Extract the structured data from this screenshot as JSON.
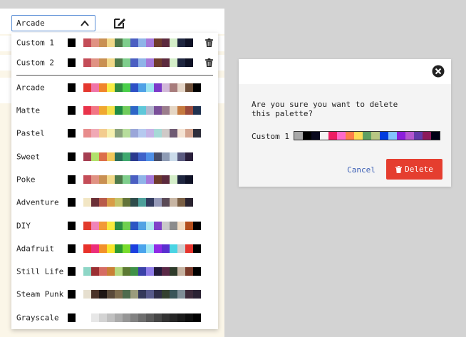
{
  "selector": {
    "selected": "Arcade"
  },
  "palettes": [
    {
      "name": "Custom 1",
      "deletable": true,
      "colors": [
        "#000000",
        "#c44d58",
        "#e09283",
        "#c99052",
        "#f1d98a",
        "#4e7a4a",
        "#7fce8d",
        "#4b5fc2",
        "#8fb4e8",
        "#a578d9",
        "#6e3b2c",
        "#5c2a3e",
        "#d4edc9",
        "#1f2640",
        "#0f1226"
      ]
    },
    {
      "name": "Custom 2",
      "deletable": true,
      "colors": [
        "#000000",
        "#c44d58",
        "#e09283",
        "#c99052",
        "#f1d98a",
        "#4e7a4a",
        "#7fce8d",
        "#4b5fc2",
        "#8fb4e8",
        "#a578d9",
        "#6e3b2c",
        "#5c2a3e",
        "#d4edc9",
        "#1f2640",
        "#0f1226"
      ]
    },
    {
      "name": "Arcade",
      "deletable": false,
      "colors": [
        "#000000",
        "#e4372f",
        "#f074a8",
        "#f0852b",
        "#f7ed45",
        "#2f8c40",
        "#4acf4b",
        "#2e50c6",
        "#4fa1e6",
        "#9be3ef",
        "#7c3ac9",
        "#d2b9d9",
        "#a77c7c",
        "#e5d6c8",
        "#6b4c36",
        "#000000"
      ]
    },
    {
      "name": "Matte",
      "deletable": false,
      "colors": [
        "#000000",
        "#e9334a",
        "#f27585",
        "#f0a830",
        "#f3e14a",
        "#1f8c45",
        "#71cc5c",
        "#2e66c7",
        "#5fc7d9",
        "#b3b6cd",
        "#7a4f99",
        "#9b7d8c",
        "#e5d6c4",
        "#c57a40",
        "#9c4a3c",
        "#203250"
      ]
    },
    {
      "name": "Pastel",
      "deletable": false,
      "colors": [
        "#000000",
        "#e88c8c",
        "#f0a9b5",
        "#f3cc8e",
        "#f6f0b0",
        "#8aa27d",
        "#b7dd9c",
        "#9aa6d9",
        "#b5c9ef",
        "#c4b3e6",
        "#a6d9d6",
        "#cfc9c7",
        "#6f5b73",
        "#f4e3d3",
        "#d4a48f",
        "#2e2e3b"
      ]
    },
    {
      "name": "Sweet",
      "deletable": false,
      "colors": [
        "#000000",
        "#a53e51",
        "#b1e16c",
        "#dc6f4a",
        "#f1c85b",
        "#2b6e5a",
        "#3fa96f",
        "#2b3a8f",
        "#3f62c9",
        "#4f8fe7",
        "#474d69",
        "#8e9bb4",
        "#cbdbea",
        "#5b5b80",
        "#2a1f3b"
      ]
    },
    {
      "name": "Poke",
      "deletable": false,
      "colors": [
        "#000000",
        "#c44d58",
        "#e09283",
        "#c99052",
        "#f1d98a",
        "#4e7a4a",
        "#7fce8d",
        "#4b5fc2",
        "#8fb4e8",
        "#a578d9",
        "#6e3b2c",
        "#5c2a3e",
        "#d4edc9",
        "#1f2640",
        "#0f1226"
      ]
    },
    {
      "name": "Adventure",
      "deletable": false,
      "colors": [
        "#000000",
        "#f2e6c4",
        "#6b2f37",
        "#b85a4a",
        "#d89c47",
        "#c4c36a",
        "#63743a",
        "#2e4c4b",
        "#4d9f9a",
        "#333b5e",
        "#9599b8",
        "#5a4a56",
        "#c7b5a3",
        "#7a5f44",
        "#2a2330"
      ]
    },
    {
      "name": "DIY",
      "deletable": false,
      "colors": [
        "#000000",
        "#e23b2c",
        "#f083b8",
        "#f29a37",
        "#f8ea3d",
        "#2b8c45",
        "#6fd04e",
        "#2b55c4",
        "#52a3e4",
        "#aee7f0",
        "#8042c8",
        "#c9c9c9",
        "#8c8c8c",
        "#f2dcc2",
        "#b34e1c",
        "#000000"
      ]
    },
    {
      "name": "Adafruit",
      "deletable": false,
      "colors": [
        "#000000",
        "#e8312a",
        "#ec2e7a",
        "#f2912a",
        "#f7e52c",
        "#2d9a31",
        "#79dc2e",
        "#1c3fe0",
        "#4aa4ec",
        "#a1e6f3",
        "#8f2be5",
        "#5a2fd0",
        "#4ad4e4",
        "#d0d0d0",
        "#e5352e",
        "#000000"
      ]
    },
    {
      "name": "Still Life",
      "deletable": false,
      "colors": [
        "#000000",
        "#8ed6c6",
        "#9b2f32",
        "#d66c63",
        "#c98036",
        "#b6d880",
        "#5c7a33",
        "#3f9148",
        "#3a41a8",
        "#8f7ce8",
        "#221a3a",
        "#5a2846",
        "#2e3b2a",
        "#c5b2a0",
        "#7a3a2a",
        "#000000"
      ]
    },
    {
      "name": "Steam Punk",
      "deletable": false,
      "colors": [
        "#000000",
        "#e6dfcf",
        "#4a3328",
        "#1e1614",
        "#5a4a3a",
        "#7d6c4e",
        "#4e6b4d",
        "#9b9c7d",
        "#34395a",
        "#575a8a",
        "#2e2d47",
        "#34402f",
        "#3a5559",
        "#7f8e97",
        "#3d2b3b",
        "#2a2233"
      ]
    },
    {
      "name": "Grayscale",
      "deletable": false,
      "colors": [
        "#000000",
        "#ffffff",
        "#e7e7e7",
        "#d3d3d3",
        "#c0c0c0",
        "#ababab",
        "#969696",
        "#828282",
        "#6e6e6e",
        "#5a5a5a",
        "#464646",
        "#333333",
        "#262626",
        "#1a1a1a",
        "#0d0d0d",
        "#000000"
      ]
    }
  ],
  "dialog": {
    "message": "Are you sure you want to delete this palette?",
    "palette_name": "Custom 1",
    "palette_colors": [
      "#a8a8a8",
      "#000000",
      "#0a0a1e",
      "#f5f5f5",
      "#ee1d64",
      "#ff69c9",
      "#ff7f49",
      "#ffdc57",
      "#5fa062",
      "#b8c683",
      "#003cde",
      "#82c3ff",
      "#8c1fdc",
      "#b557cf",
      "#623aa9",
      "#8c1b5a",
      "#000016"
    ],
    "cancel_label": "Cancel",
    "delete_label": "Delete"
  },
  "icons": {
    "dropdown": "chevron-up-icon",
    "edit": "edit-icon",
    "trash": "trash-icon",
    "close": "close-circle-icon"
  }
}
